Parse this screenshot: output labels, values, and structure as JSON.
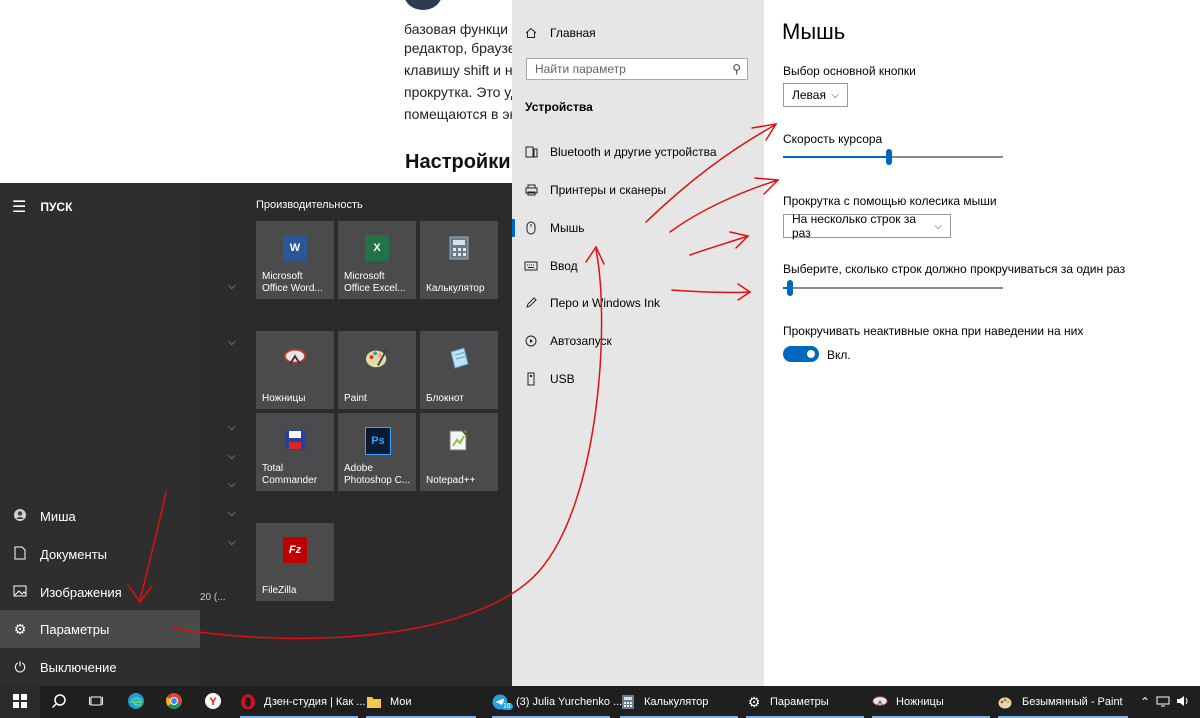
{
  "article": {
    "lines": [
      "базовая функци",
      "редактор, браузер",
      "клавишу shift и на",
      "прокрутка. Это уд",
      "помещаются в экр"
    ],
    "heading": "Настройки м"
  },
  "settings_nav": {
    "home": "Главная",
    "search_placeholder": "Найти параметр",
    "section": "Устройства",
    "items": [
      {
        "label": "Bluetooth и другие устройства",
        "icon": "bluetooth-devices-icon"
      },
      {
        "label": "Принтеры и сканеры",
        "icon": "printer-icon"
      },
      {
        "label": "Мышь",
        "icon": "mouse-icon"
      },
      {
        "label": "Ввод",
        "icon": "keyboard-icon"
      },
      {
        "label": "Перо и Windows Ink",
        "icon": "pen-icon"
      },
      {
        "label": "Автозапуск",
        "icon": "autoplay-icon"
      },
      {
        "label": "USB",
        "icon": "usb-icon"
      }
    ],
    "active": "Мышь"
  },
  "settings_content": {
    "title": "Мышь",
    "primary_button_label": "Выбор основной кнопки",
    "primary_button_value": "Левая",
    "cursor_speed_label": "Скорость курсора",
    "cursor_speed_level": 0.48,
    "scroll_label": "Прокрутка с помощью колесика мыши",
    "scroll_value": "На несколько строк за раз",
    "lines_label": "Выберите, сколько строк должно прокручиваться за один раз",
    "lines_level": 0.03,
    "inactive_label": "Прокручивать неактивные окна при наведении на них",
    "inactive_value": "Вкл.",
    "accent": "#0067c0"
  },
  "start_menu": {
    "title": "ПУСК",
    "group_title": "Производительность",
    "partial_text": "20 (...",
    "left_items": [
      {
        "label": "Миша",
        "icon": "user-icon"
      },
      {
        "label": "Документы",
        "icon": "document-icon"
      },
      {
        "label": "Изображения",
        "icon": "pictures-icon"
      },
      {
        "label": "Параметры",
        "icon": "gear-icon"
      },
      {
        "label": "Выключение",
        "icon": "power-icon"
      }
    ],
    "tiles": [
      {
        "label": "Microsoft Office Word...",
        "icon": "W",
        "color": "#2b579a"
      },
      {
        "label": "Microsoft Office Excel...",
        "icon": "X",
        "color": "#217346"
      },
      {
        "label": "Калькулятор",
        "icon": "calculator",
        "color": "#6a7b8a"
      },
      {
        "label": "Ножницы",
        "icon": "scissors",
        "color": "#c0392b"
      },
      {
        "label": "Paint",
        "icon": "palette",
        "color": "#d9a441"
      },
      {
        "label": "Блокнот",
        "icon": "notepad",
        "color": "#5aa0c8"
      },
      {
        "label": "Total Commander",
        "icon": "floppy",
        "color": "#2c3e9e"
      },
      {
        "label": "Adobe Photoshop C...",
        "icon": "Ps",
        "color": "#0a1a33"
      },
      {
        "label": "Notepad++",
        "icon": "notepad++",
        "color": "#8bc34a"
      },
      {
        "label": "FileZilla",
        "icon": "Fz",
        "color": "#bf0000"
      }
    ]
  },
  "taskbar": {
    "items": [
      {
        "label": "",
        "icon": "windows-start-icon"
      },
      {
        "label": "",
        "icon": "search-icon"
      },
      {
        "label": "",
        "icon": "task-view-icon"
      },
      {
        "label": "",
        "icon": "edge-icon"
      },
      {
        "label": "",
        "icon": "chrome-icon"
      },
      {
        "label": "",
        "icon": "yandex-icon"
      },
      {
        "label": "Дзен-студия | Как ...",
        "icon": "opera-icon"
      },
      {
        "label": "Мои",
        "icon": "folder-icon"
      },
      {
        "label": "(3) Julia Yurchenko ...",
        "icon": "telegram-icon"
      },
      {
        "label": "Калькулятор",
        "icon": "calculator-icon"
      },
      {
        "label": "Параметры",
        "icon": "gear-icon"
      },
      {
        "label": "Ножницы",
        "icon": "scissors-icon"
      },
      {
        "label": "Безымянный - Paint",
        "icon": "paint-icon"
      }
    ],
    "telegram_badge": "16",
    "tray_icons": [
      "chevron-up-icon",
      "network-icon",
      "volume-icon"
    ]
  }
}
